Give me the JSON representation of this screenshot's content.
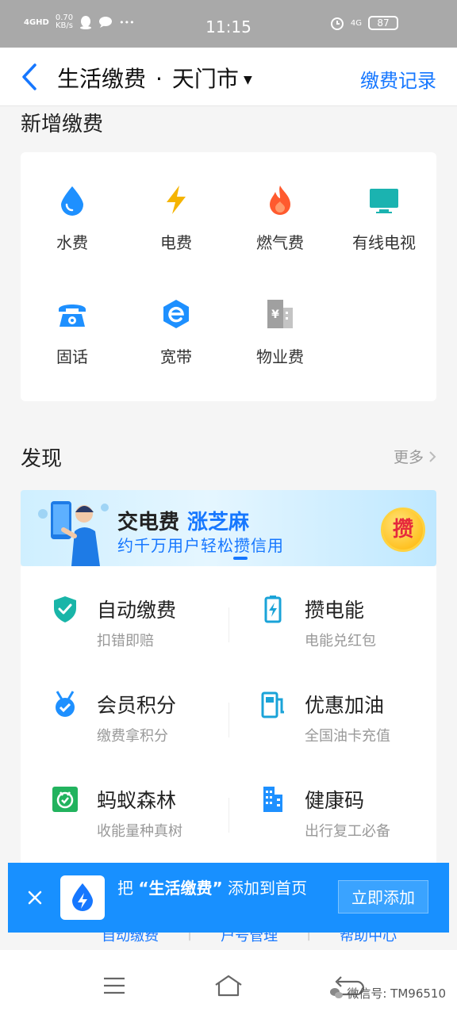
{
  "status_bar": {
    "network": "4GHD",
    "speed": "0.70\nKB/s",
    "time": "11:15",
    "signal_right": "4G",
    "battery": "87"
  },
  "header": {
    "title": "生活缴费",
    "separator": "·",
    "city": "天门市",
    "city_arrow": "▼",
    "record_link": "缴费记录"
  },
  "new_payment": {
    "title": "新增缴费",
    "items": [
      {
        "label": "水费",
        "icon": "water-drop-icon",
        "color": "#1e90ff"
      },
      {
        "label": "电费",
        "icon": "lightning-icon",
        "color": "#f5b400"
      },
      {
        "label": "燃气费",
        "icon": "flame-icon",
        "color": "#ff5a2e"
      },
      {
        "label": "有线电视",
        "icon": "tv-icon",
        "color": "#1bb3b0"
      },
      {
        "label": "固话",
        "icon": "telephone-icon",
        "color": "#1e90ff"
      },
      {
        "label": "宽带",
        "icon": "broadband-icon",
        "color": "#1e90ff"
      },
      {
        "label": "物业费",
        "icon": "building-icon",
        "color": "#a0a0a0"
      }
    ]
  },
  "discover": {
    "title": "发现",
    "more": "更多",
    "banner": {
      "title": "交电费",
      "highlight": "涨芝麻",
      "subtitle": "约千万用户轻松攒信用",
      "badge": "攒"
    },
    "items": [
      {
        "title": "自动缴费",
        "subtitle": "扣错即赔",
        "icon": "shield-check-icon"
      },
      {
        "title": "攒电能",
        "subtitle": "电能兑红包",
        "icon": "battery-icon"
      },
      {
        "title": "会员积分",
        "subtitle": "缴费拿积分",
        "icon": "medal-icon"
      },
      {
        "title": "优惠加油",
        "subtitle": "全国油卡充值",
        "icon": "fuel-pump-icon"
      },
      {
        "title": "蚂蚁森林",
        "subtitle": "收能量种真树",
        "icon": "tree-icon"
      },
      {
        "title": "健康码",
        "subtitle": "出行复工必备",
        "icon": "building-icon"
      }
    ]
  },
  "bottom_links": [
    "自动缴费",
    "户号管理",
    "帮助中心"
  ],
  "add_bar": {
    "text_prefix": "把",
    "app_name": "“生活缴费”",
    "text_suffix": "添加到首页",
    "button": "立即添加"
  },
  "watermark": "微信号: TM96510",
  "colors": {
    "primary": "#1677ff",
    "addbar": "#1890ff"
  }
}
